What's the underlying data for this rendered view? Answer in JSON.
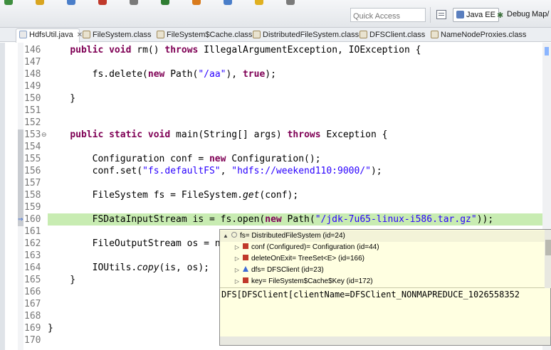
{
  "toolbar": {
    "quick_access_placeholder": "Quick Access",
    "perspectives": [
      {
        "label": "Java EE",
        "icon": "java-ee-perspective-icon",
        "active": true
      },
      {
        "label": "Debug",
        "icon": "debug-perspective-icon",
        "active": false
      },
      {
        "label": "Map/",
        "icon": "mapreduce-perspective-icon",
        "active": false
      }
    ],
    "icon_strip_colors": [
      "#3e8e3e",
      "#d9a520",
      "#4a7ec9",
      "#c0392b",
      "#7a7a7a",
      "#2f7d32",
      "#d97b1d",
      "#4a7ec9",
      "#e0b020",
      "#7a7a7a"
    ]
  },
  "tabs": [
    {
      "label": "HdfsUtil.java",
      "icon": "java-file-icon",
      "active": true,
      "closable": true
    },
    {
      "label": "FileSystem.class",
      "icon": "class-file-icon",
      "active": false
    },
    {
      "label": "FileSystem$Cache.class",
      "icon": "class-file-icon",
      "active": false
    },
    {
      "label": "DistributedFileSystem.class",
      "icon": "class-file-icon",
      "active": false
    },
    {
      "label": "DFSClient.class",
      "icon": "class-file-icon",
      "active": false
    },
    {
      "label": "NameNodeProxies.class",
      "icon": "class-file-icon",
      "active": false
    }
  ],
  "editor": {
    "lines": [
      {
        "n": "146",
        "code": [
          [
            "    "
          ],
          [
            "public",
            "kw"
          ],
          [
            " "
          ],
          [
            "void",
            "kw"
          ],
          [
            " rm() "
          ],
          [
            "throws",
            "kw"
          ],
          [
            " IllegalArgumentException, IOException {"
          ]
        ]
      },
      {
        "n": "147",
        "code": []
      },
      {
        "n": "148",
        "code": [
          [
            "        fs.delete("
          ],
          [
            "new",
            "kw"
          ],
          [
            " Path("
          ],
          [
            "\"/aa\"",
            "str"
          ],
          [
            "), "
          ],
          [
            "true",
            "kw"
          ],
          [
            ");"
          ]
        ]
      },
      {
        "n": "149",
        "code": []
      },
      {
        "n": "150",
        "code": [
          [
            "    }"
          ]
        ]
      },
      {
        "n": "151",
        "code": []
      },
      {
        "n": "152",
        "code": []
      },
      {
        "n": "153",
        "fold": true,
        "code": [
          [
            "    "
          ],
          [
            "public",
            "kw"
          ],
          [
            " "
          ],
          [
            "static",
            "kw"
          ],
          [
            " "
          ],
          [
            "void",
            "kw"
          ],
          [
            " main(String[] args) "
          ],
          [
            "throws",
            "kw"
          ],
          [
            " Exception {"
          ]
        ]
      },
      {
        "n": "154",
        "code": []
      },
      {
        "n": "155",
        "code": [
          [
            "        Configuration conf = "
          ],
          [
            "new",
            "kw"
          ],
          [
            " Configuration();"
          ]
        ]
      },
      {
        "n": "156",
        "code": [
          [
            "        conf.set("
          ],
          [
            "\"fs.defaultFS\"",
            "str"
          ],
          [
            ", "
          ],
          [
            "\"hdfs://weekend110:9000/\"",
            "str"
          ],
          [
            ");"
          ]
        ]
      },
      {
        "n": "157",
        "code": []
      },
      {
        "n": "158",
        "code": [
          [
            "        FileSystem fs = FileSystem."
          ],
          [
            "get",
            "it"
          ],
          [
            "(conf);"
          ]
        ]
      },
      {
        "n": "159",
        "code": []
      },
      {
        "n": "160",
        "current": true,
        "code": [
          [
            "        FSDataInputStream is = fs.open("
          ],
          [
            "new",
            "kw"
          ],
          [
            " Path("
          ],
          [
            "\"/jdk-7u65-linux-i586.tar.gz\"",
            "str"
          ],
          [
            "));"
          ]
        ]
      },
      {
        "n": "161",
        "code": []
      },
      {
        "n": "162",
        "code": [
          [
            "        FileOutputStream os = n"
          ]
        ]
      },
      {
        "n": "163",
        "code": []
      },
      {
        "n": "164",
        "code": [
          [
            "        IOUtils."
          ],
          [
            "copy",
            "it"
          ],
          [
            "(is, os);"
          ]
        ]
      },
      {
        "n": "165",
        "code": [
          [
            "    }"
          ]
        ]
      },
      {
        "n": "166",
        "code": []
      },
      {
        "n": "167",
        "code": []
      },
      {
        "n": "168",
        "code": []
      },
      {
        "n": "169",
        "code": [
          [
            "}"
          ]
        ]
      },
      {
        "n": "170",
        "code": []
      }
    ]
  },
  "popup": {
    "rows": [
      {
        "twisty": "▲",
        "icon": "object-icon",
        "icon_color": "#8a8a8a",
        "text": "fs= DistributedFileSystem  (id=24)",
        "indent": 0,
        "selected": true
      },
      {
        "twisty": "▷",
        "icon": "field-icon",
        "icon_color": "#c0392b",
        "text": "conf (Configured)= Configuration  (id=44)",
        "indent": 1
      },
      {
        "twisty": "▷",
        "icon": "field-icon",
        "icon_color": "#c0392b",
        "text": "deleteOnExit= TreeSet<E>  (id=166)",
        "indent": 1
      },
      {
        "twisty": "▷",
        "icon": "field-icon",
        "icon_color": "#3c6bd6",
        "text": "dfs= DFSClient  (id=23)",
        "indent": 1
      },
      {
        "twisty": "▷",
        "icon": "field-icon",
        "icon_color": "#c0392b",
        "text": "key= FileSystem$Cache$Key  (id=172)",
        "indent": 1
      }
    ],
    "detail": "DFS[DFSClient[clientName=DFSClient_NONMAPREDUCE_1026558352"
  }
}
